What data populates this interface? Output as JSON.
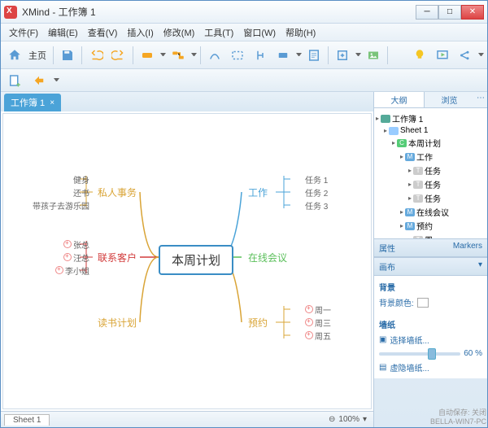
{
  "window": {
    "title": "XMind - 工作簿 1"
  },
  "menu": [
    "文件(F)",
    "编辑(E)",
    "查看(V)",
    "插入(I)",
    "修改(M)",
    "工具(T)",
    "窗口(W)",
    "帮助(H)"
  ],
  "toolbar": {
    "home": "主页"
  },
  "tabs": [
    {
      "label": "工作簿 1"
    }
  ],
  "mindmap": {
    "central": "本周计划",
    "left": [
      {
        "label": "私人事务",
        "color": "#d9a436",
        "children": [
          "健身",
          "还书",
          "带孩子去游乐园"
        ]
      },
      {
        "label": "联系客户",
        "color": "#d23b3b",
        "children": [
          "张总",
          "汪总",
          "李小姐"
        ],
        "markers": true
      },
      {
        "label": "读书计划",
        "color": "#d9a436",
        "children": []
      }
    ],
    "right": [
      {
        "label": "工作",
        "color": "#4aa3d8",
        "children": [
          "任务 1",
          "任务 2",
          "任务 3"
        ]
      },
      {
        "label": "在线会议",
        "color": "#5abf5a",
        "children": []
      },
      {
        "label": "预约",
        "color": "#d9a436",
        "children": [
          "周一",
          "周三",
          "周五"
        ],
        "markers": true
      }
    ]
  },
  "sheet_tab": "Sheet 1",
  "zoom": "100%",
  "side": {
    "tabs": [
      "大纲",
      "浏览"
    ],
    "outline": [
      {
        "indent": 0,
        "icon": "wb",
        "label": "工作簿 1"
      },
      {
        "indent": 1,
        "icon": "sh",
        "label": "Sheet 1"
      },
      {
        "indent": 2,
        "icon": "c",
        "label": "本周计划"
      },
      {
        "indent": 3,
        "icon": "m",
        "label": "工作"
      },
      {
        "indent": 4,
        "icon": "t",
        "label": "任务"
      },
      {
        "indent": 4,
        "icon": "t",
        "label": "任务"
      },
      {
        "indent": 4,
        "icon": "t",
        "label": "任务"
      },
      {
        "indent": 3,
        "icon": "m",
        "label": "在线会议"
      },
      {
        "indent": 3,
        "icon": "m",
        "label": "预约"
      },
      {
        "indent": 4,
        "icon": "t",
        "label": "周"
      }
    ],
    "props_title": "属性",
    "markers_title": "Markers",
    "canvas_title": "画布",
    "bg_section": "背景",
    "bg_color": "背景颜色:",
    "wallpaper_section": "墙纸",
    "select_wallpaper": "选择墙纸...",
    "opacity": "60 %",
    "fade_wallpaper": "虚隐墙纸..."
  },
  "footer": {
    "line1": "自动保存: 关闭",
    "line2": "BELLA-WIN7-PC"
  }
}
